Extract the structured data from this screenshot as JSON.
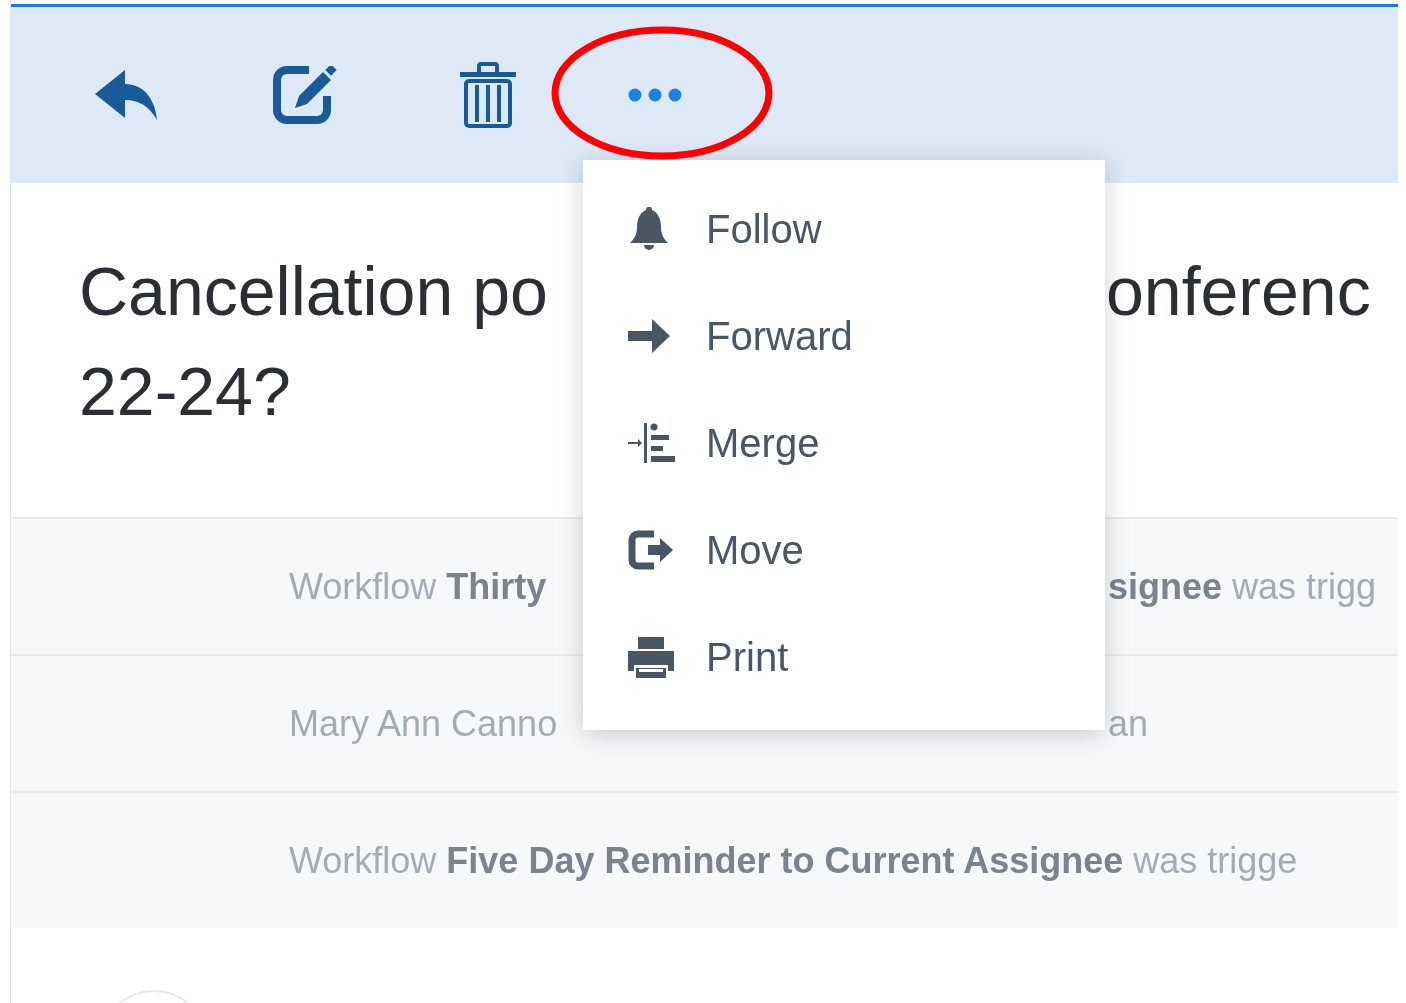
{
  "toolbar": [
    {
      "kind": "reply"
    },
    {
      "kind": "edit"
    },
    {
      "kind": "delete"
    },
    {
      "kind": "more"
    }
  ],
  "title": {
    "line_1_left": "Cancellation po",
    "line_1_right": "onferenc",
    "line_2": "22-24?"
  },
  "activity": [
    {
      "left": "Workflow **Thirty**",
      "right": "**signee** was trigg"
    },
    {
      "left": "Mary Ann Canno",
      "right": "an"
    },
    {
      "left": "Workflow **Five Day Reminder to Current Assignee** was trigge"
    }
  ],
  "menu": [
    {
      "kind": "bell",
      "label": "Follow"
    },
    {
      "kind": "arrow",
      "label": "Forward"
    },
    {
      "kind": "merge",
      "label": "Merge"
    },
    {
      "kind": "move",
      "label": "Move"
    },
    {
      "kind": "print",
      "label": "Print"
    }
  ]
}
